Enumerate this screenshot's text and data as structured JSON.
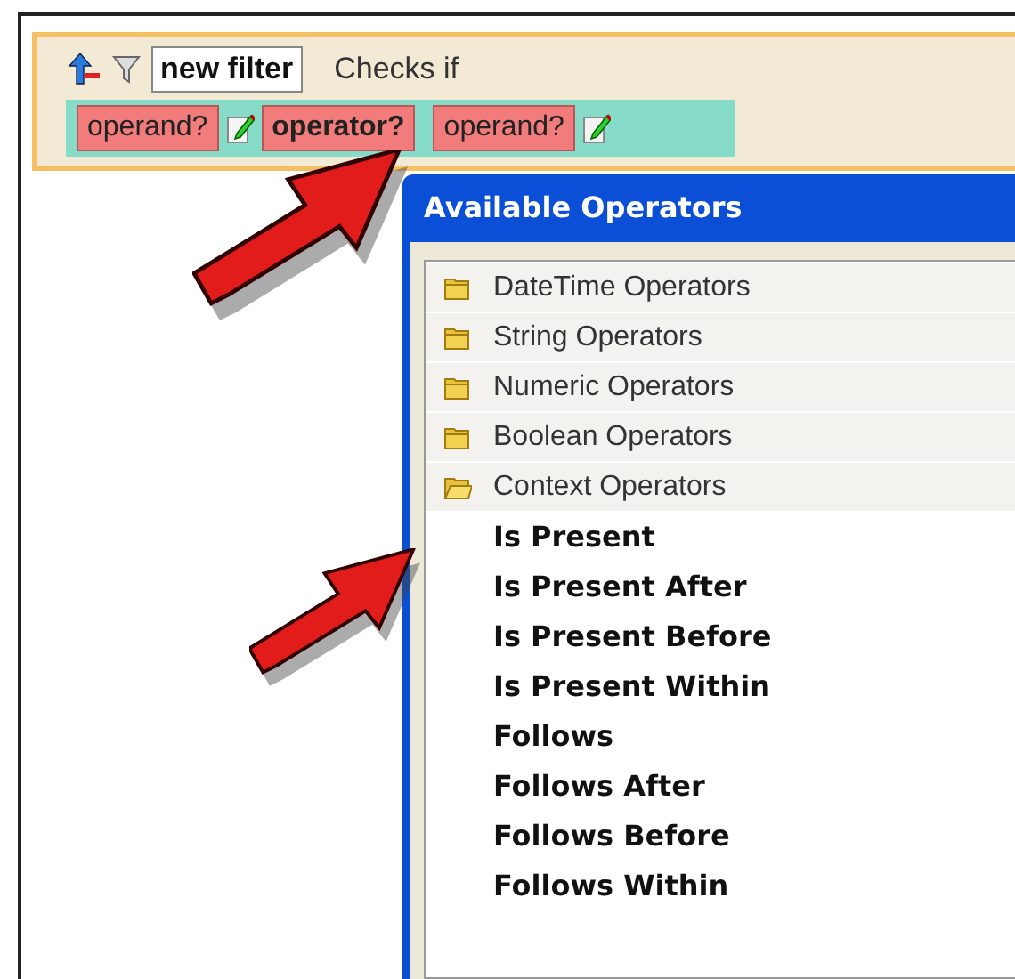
{
  "filter": {
    "name": "new filter",
    "label": "Checks if",
    "expression": [
      {
        "kind": "operand",
        "text": "operand?",
        "editable": true
      },
      {
        "kind": "operator",
        "text": "operator?",
        "editable": false
      },
      {
        "kind": "operand",
        "text": "operand?",
        "editable": true
      }
    ]
  },
  "dialog": {
    "title": "Available Operators",
    "tree": [
      {
        "label": "DateTime Operators",
        "expanded": false
      },
      {
        "label": "String Operators",
        "expanded": false
      },
      {
        "label": "Numeric Operators",
        "expanded": false
      },
      {
        "label": "Boolean Operators",
        "expanded": false
      },
      {
        "label": "Context Operators",
        "expanded": true,
        "children": [
          {
            "label": "Is Present"
          },
          {
            "label": "Is Present After"
          },
          {
            "label": "Is Present Before"
          },
          {
            "label": "Is Present Within"
          },
          {
            "label": "Follows"
          },
          {
            "label": "Follows After"
          },
          {
            "label": "Follows Before"
          },
          {
            "label": "Follows Within"
          }
        ]
      }
    ]
  }
}
